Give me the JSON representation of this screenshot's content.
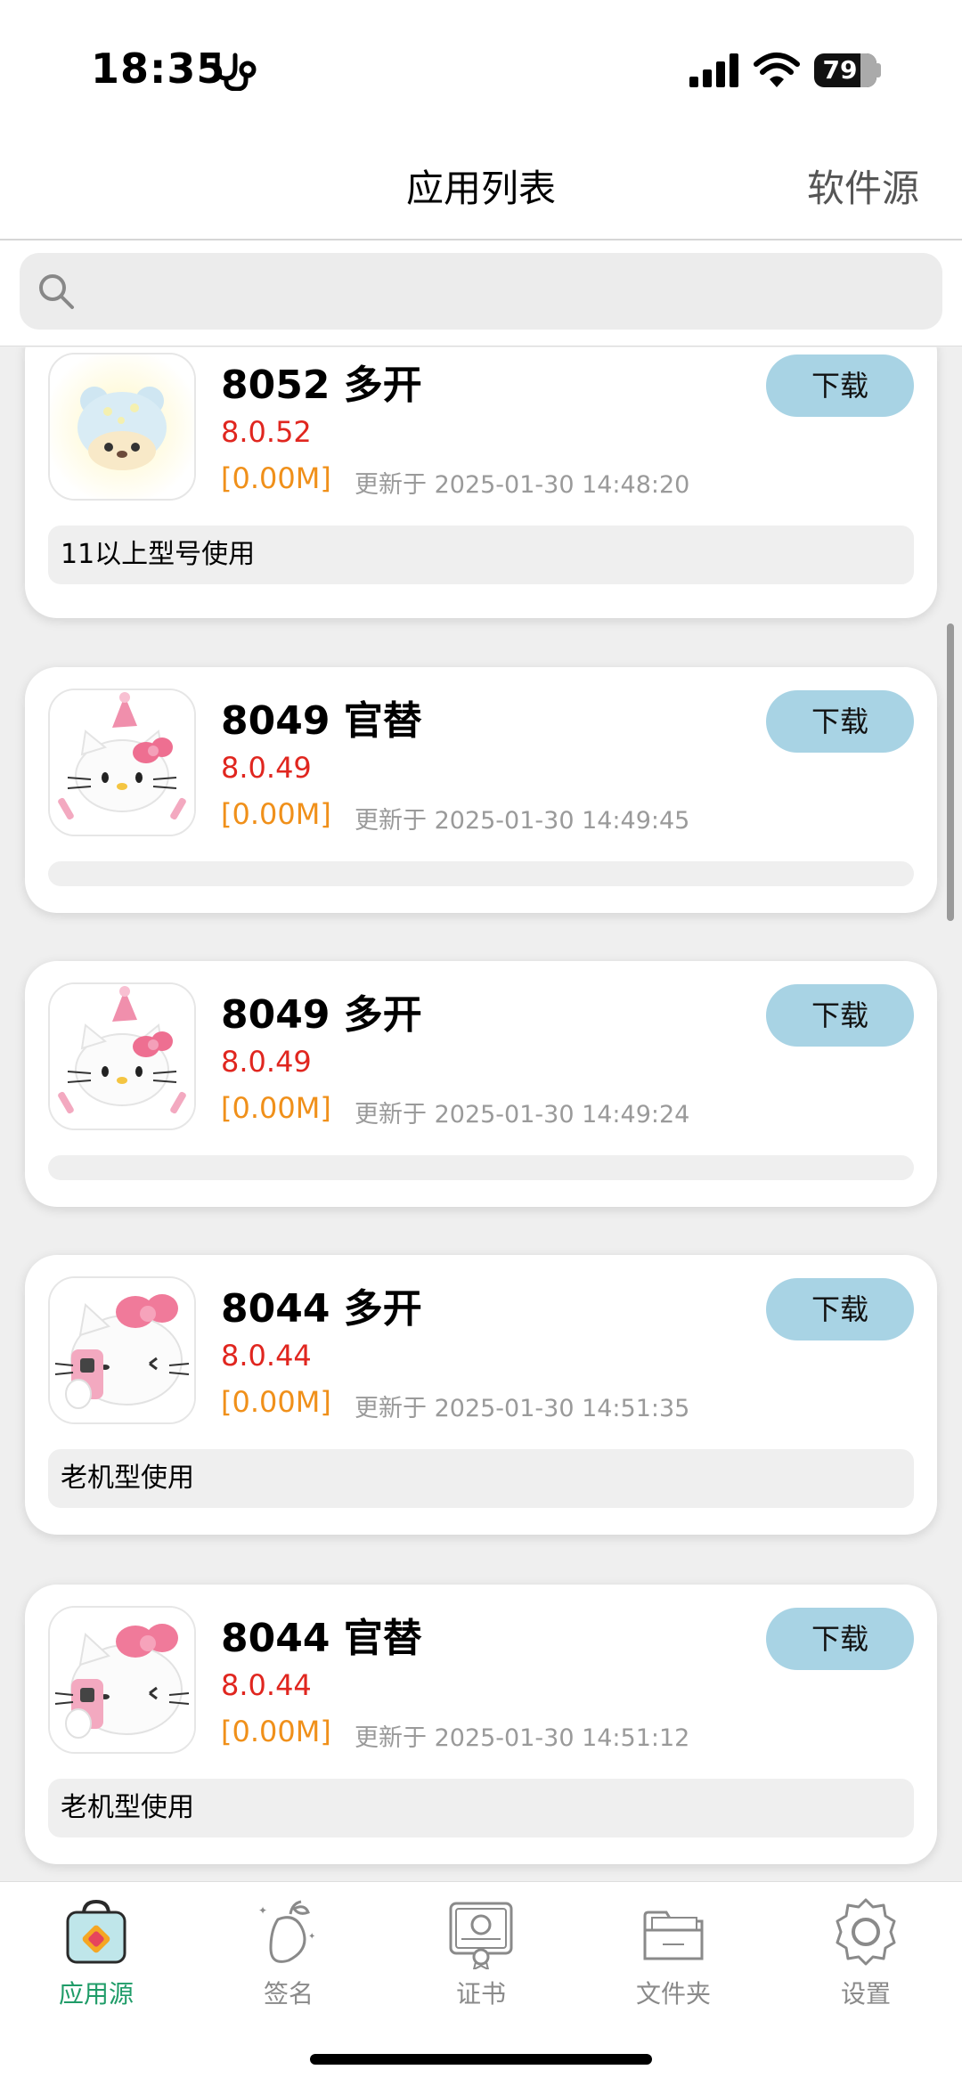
{
  "status": {
    "time": "18:35",
    "battery": "79"
  },
  "nav": {
    "title": "应用列表",
    "right": "软件源"
  },
  "search": {
    "placeholder": ""
  },
  "apps": [
    {
      "name": "8052 多开",
      "version": "8.0.52",
      "size": "[0.00M]",
      "date": "更新于 2025-01-30 14:48:20",
      "note": "11以上型号使用",
      "button": "下载",
      "icon": "bear-icon"
    },
    {
      "name": "8049 官替",
      "version": "8.0.49",
      "size": "[0.00M]",
      "date": "更新于 2025-01-30 14:49:45",
      "note": "",
      "button": "下载",
      "icon": "kitty-party-icon"
    },
    {
      "name": "8049 多开",
      "version": "8.0.49",
      "size": "[0.00M]",
      "date": "更新于 2025-01-30 14:49:24",
      "note": "",
      "button": "下载",
      "icon": "kitty-party-icon"
    },
    {
      "name": "8044 多开",
      "version": "8.0.44",
      "size": "[0.00M]",
      "date": "更新于 2025-01-30 14:51:35",
      "note": "老机型使用",
      "button": "下载",
      "icon": "kitty-phone-icon"
    },
    {
      "name": "8044 官替",
      "version": "8.0.44",
      "size": "[0.00M]",
      "date": "更新于 2025-01-30 14:51:12",
      "note": "老机型使用",
      "button": "下载",
      "icon": "kitty-phone-icon"
    }
  ],
  "tabs": [
    {
      "label": "应用源",
      "icon": "app-source-icon",
      "active": true
    },
    {
      "label": "签名",
      "icon": "signature-icon",
      "active": false
    },
    {
      "label": "证书",
      "icon": "certificate-icon",
      "active": false
    },
    {
      "label": "文件夹",
      "icon": "folder-icon",
      "active": false
    },
    {
      "label": "设置",
      "icon": "settings-icon",
      "active": false
    }
  ],
  "colors": {
    "accent": "#1f9c68",
    "version": "#e0261f",
    "size": "#f0901a",
    "button": "#a8d3e4"
  }
}
